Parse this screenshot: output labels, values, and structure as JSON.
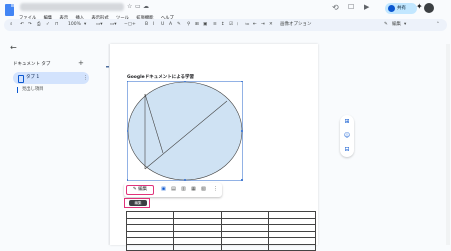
{
  "header": {
    "share_label": "共有",
    "menu": [
      "ファイル",
      "編集",
      "表示",
      "挿入",
      "表示形式",
      "ツール",
      "拡張機能",
      "ヘルプ"
    ]
  },
  "toolbar": {
    "zoom": "100%",
    "image_options": "画像オプション",
    "mode_label": "編集"
  },
  "sidebar": {
    "title": "ドキュメント タブ",
    "add_label": "+",
    "tab1_label": "タブ 1",
    "heading_label": "見出し項目"
  },
  "document": {
    "title_text": "Googleドキュメントによる学習",
    "edit_button_label": "編集",
    "tooltip_text": "編集"
  },
  "colors": {
    "accent": "#0b57d0",
    "shape_fill": "#cfe2f3",
    "highlight": "#e0337a"
  }
}
